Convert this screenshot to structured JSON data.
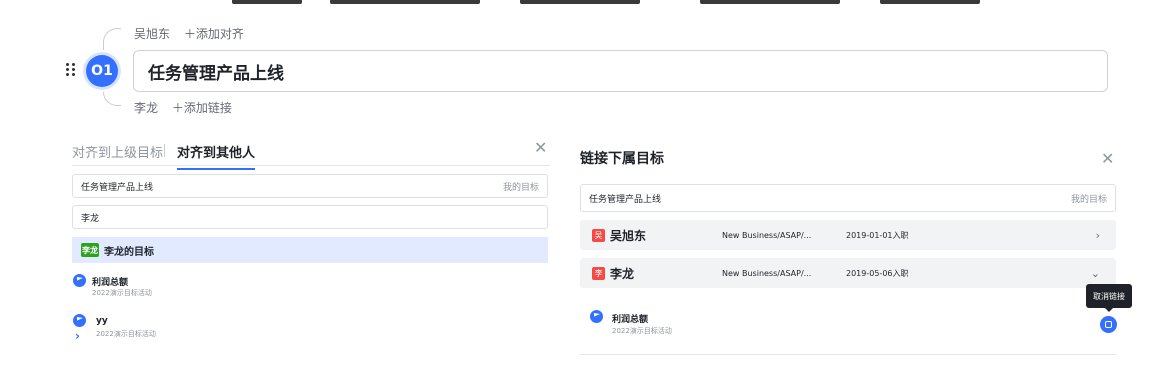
{
  "header": {
    "owner": "吴旭东",
    "add_align": "＋添加对齐",
    "badge": "O1",
    "objective_title": "任务管理产品上线",
    "sub_owner": "李龙",
    "add_link": "＋添加链接"
  },
  "align_panel": {
    "tabs": [
      "对齐到上级目标",
      "对齐到其他人"
    ],
    "active_tab": 1,
    "search_value": "任务管理产品上线",
    "search_tag": "我的目标",
    "person_value": "李龙",
    "group_badge": "李龙",
    "group_label": "李龙的目标",
    "goals": [
      {
        "title": "利润总额",
        "subtitle": "2022演示目标活动"
      },
      {
        "title": "yy",
        "subtitle": "2022演示目标活动"
      }
    ],
    "close_icon": "close-icon"
  },
  "link_panel": {
    "title": "链接下属目标",
    "search_value": "任务管理产品上线",
    "search_tag": "我的目标",
    "rows": [
      {
        "badge": "吴",
        "badge_color": "#f54a45",
        "name": "吴旭东",
        "org": "New Business/ASAP/...",
        "date": "2019-01-01入职",
        "expanded": false
      },
      {
        "badge": "李",
        "badge_color": "#f54a45",
        "name": "李龙",
        "org": "New Business/ASAP/...",
        "date": "2019-05-06入职",
        "expanded": true
      }
    ],
    "linked_goal": {
      "title": "利润总额",
      "subtitle": "2022演示目标活动"
    },
    "tooltip": "取消链接"
  },
  "colors": {
    "accent": "#3370ff",
    "group_green": "#2ea121"
  }
}
